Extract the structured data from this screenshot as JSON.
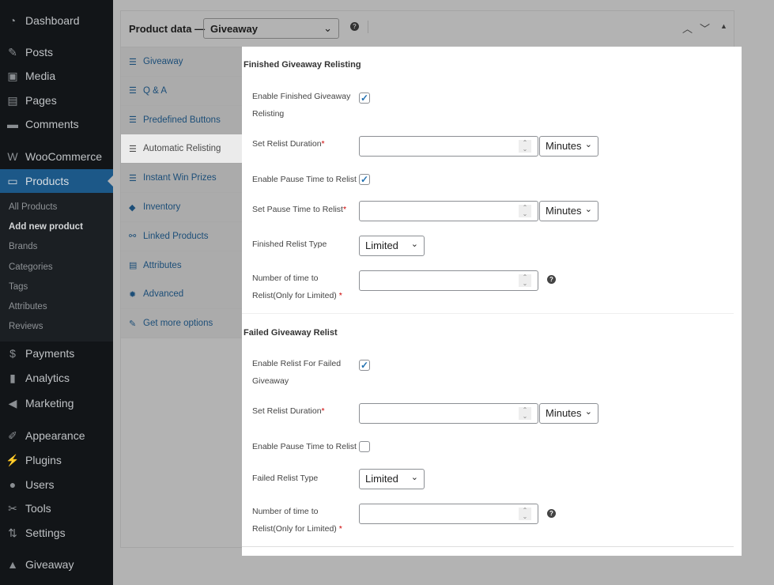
{
  "sidebar": {
    "items": [
      {
        "label": "Dashboard",
        "icon": "dashboard-icon",
        "glyph": "◔"
      },
      {
        "label": "Posts",
        "icon": "pin-icon",
        "glyph": "✎"
      },
      {
        "label": "Media",
        "icon": "media-icon",
        "glyph": "▣"
      },
      {
        "label": "Pages",
        "icon": "pages-icon",
        "glyph": "▤"
      },
      {
        "label": "Comments",
        "icon": "comment-icon",
        "glyph": "▬"
      },
      {
        "label": "WooCommerce",
        "icon": "woo-icon",
        "glyph": "W"
      },
      {
        "label": "Products",
        "icon": "products-icon",
        "glyph": "▭",
        "active": true
      },
      {
        "label": "Payments",
        "icon": "payments-icon",
        "glyph": "$"
      },
      {
        "label": "Analytics",
        "icon": "analytics-icon",
        "glyph": "▮"
      },
      {
        "label": "Marketing",
        "icon": "megaphone-icon",
        "glyph": "◀"
      },
      {
        "label": "Appearance",
        "icon": "brush-icon",
        "glyph": "✐"
      },
      {
        "label": "Plugins",
        "icon": "plug-icon",
        "glyph": "⚡"
      },
      {
        "label": "Users",
        "icon": "user-icon",
        "glyph": "●"
      },
      {
        "label": "Tools",
        "icon": "wrench-icon",
        "glyph": "✂"
      },
      {
        "label": "Settings",
        "icon": "settings-icon",
        "glyph": "⇅"
      },
      {
        "label": "Giveaway",
        "icon": "giveaway-icon",
        "glyph": "▲"
      }
    ],
    "submenu": [
      {
        "label": "All Products"
      },
      {
        "label": "Add new product",
        "current": true
      },
      {
        "label": "Brands"
      },
      {
        "label": "Categories"
      },
      {
        "label": "Tags"
      },
      {
        "label": "Attributes"
      },
      {
        "label": "Reviews"
      }
    ]
  },
  "header": {
    "title": "Product data —",
    "product_type": "Giveaway"
  },
  "tabs": [
    {
      "label": "Giveaway",
      "glyph": "☰"
    },
    {
      "label": "Q & A",
      "glyph": "☰"
    },
    {
      "label": "Predefined Buttons",
      "glyph": "☰"
    },
    {
      "label": "Automatic Relisting",
      "glyph": "☰",
      "active": true
    },
    {
      "label": "Instant Win Prizes",
      "glyph": "☰"
    },
    {
      "label": "Inventory",
      "glyph": "◆"
    },
    {
      "label": "Linked Products",
      "glyph": "⚯"
    },
    {
      "label": "Attributes",
      "glyph": "▤"
    },
    {
      "label": "Advanced",
      "glyph": "✹"
    },
    {
      "label": "Get more options",
      "glyph": "✎"
    }
  ],
  "finished": {
    "heading": "Finished Giveaway Relisting",
    "enable_label": "Enable Finished Giveaway Relisting",
    "enable_checked": true,
    "duration_label": "Set Relist Duration",
    "duration_value": "",
    "duration_unit": "Minutes",
    "pause_enable_label": "Enable Pause Time to Relist",
    "pause_enable_checked": true,
    "pause_label": "Set Pause Time to Relist",
    "pause_value": "",
    "pause_unit": "Minutes",
    "type_label": "Finished Relist Type",
    "type_value": "Limited",
    "count_label": "Number of time to Relist(Only for Limited)",
    "count_value": ""
  },
  "failed": {
    "heading": "Failed Giveaway Relist",
    "enable_label": "Enable Relist For Failed Giveaway",
    "enable_checked": true,
    "duration_label": "Set Relist Duration",
    "duration_value": "",
    "duration_unit": "Minutes",
    "pause_enable_label": "Enable Pause Time to Relist",
    "pause_enable_checked": false,
    "type_label": "Failed Relist Type",
    "type_value": "Limited",
    "count_label": "Number of time to Relist(Only for Limited)",
    "count_value": ""
  },
  "required_mark": "*",
  "help_glyph": "?"
}
